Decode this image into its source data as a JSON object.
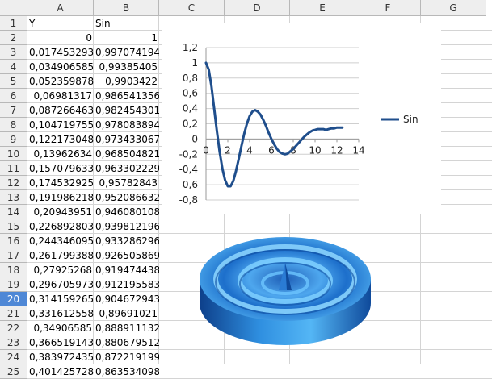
{
  "columns": [
    "A",
    "B",
    "C",
    "D",
    "E",
    "F",
    "G"
  ],
  "rows": [
    "1",
    "2",
    "3",
    "4",
    "5",
    "6",
    "7",
    "8",
    "9",
    "10",
    "11",
    "12",
    "13",
    "14",
    "15",
    "16",
    "17",
    "18",
    "19",
    "20",
    "21",
    "22",
    "23",
    "24",
    "25"
  ],
  "selected_row": "20",
  "headers": {
    "a1": "Y",
    "b1": "Sin"
  },
  "cells_a": [
    "0",
    "0,017453293",
    "0,034906585",
    "0,052359878",
    "0,06981317",
    "0,087266463",
    "0,104719755",
    "0,122173048",
    "0,13962634",
    "0,157079633",
    "0,174532925",
    "0,191986218",
    "0,20943951",
    "0,226892803",
    "0,244346095",
    "0,261799388",
    "0,27925268",
    "0,296705973",
    "0,314159265",
    "0,331612558",
    "0,34906585",
    "0,366519143",
    "0,383972435",
    "0,401425728"
  ],
  "cells_b": [
    "1",
    "0,997074194",
    "0,99385405",
    "0,9903422",
    "0,986541356",
    "0,982454301",
    "0,978083894",
    "0,973433067",
    "0,968504821",
    "0,963302229",
    "0,95782843",
    "0,952086632",
    "0,946080108",
    "0,939812196",
    "0,933286296",
    "0,926505869",
    "0,919474438",
    "0,912195583",
    "0,904672943",
    "0,89691021",
    "0,888911132",
    "0,880679512",
    "0,872219199",
    "0,863534098"
  ],
  "chart_data": {
    "type": "line",
    "series": [
      {
        "name": "Sin",
        "color": "#1f4e8c",
        "x": [
          0,
          0.25,
          0.5,
          0.75,
          1,
          1.25,
          1.5,
          1.75,
          2,
          2.25,
          2.5,
          2.75,
          3,
          3.25,
          3.5,
          3.75,
          4,
          4.25,
          4.5,
          4.75,
          5,
          5.25,
          5.5,
          5.75,
          6,
          6.25,
          6.5,
          6.75,
          7,
          7.25,
          7.5,
          7.75,
          8,
          8.25,
          8.5,
          8.75,
          9,
          9.25,
          9.5,
          9.75,
          10,
          10.25,
          10.5,
          10.75,
          11,
          11.25,
          11.5,
          11.75,
          12,
          12.25,
          12.5
        ],
        "y": [
          1,
          0.91,
          0.69,
          0.4,
          0.1,
          -0.17,
          -0.39,
          -0.54,
          -0.62,
          -0.62,
          -0.55,
          -0.42,
          -0.26,
          -0.09,
          0.07,
          0.2,
          0.3,
          0.36,
          0.38,
          0.36,
          0.32,
          0.25,
          0.17,
          0.08,
          0.0,
          -0.07,
          -0.13,
          -0.17,
          -0.19,
          -0.2,
          -0.19,
          -0.16,
          -0.13,
          -0.09,
          -0.05,
          -0.01,
          0.03,
          0.06,
          0.09,
          0.11,
          0.12,
          0.13,
          0.13,
          0.13,
          0.12,
          0.13,
          0.14,
          0.14,
          0.15,
          0.15,
          0.15
        ]
      }
    ],
    "xlim": [
      0,
      14
    ],
    "ylim": [
      -0.8,
      1.2
    ],
    "x_ticks": [
      "0",
      "2",
      "4",
      "6",
      "8",
      "10",
      "12",
      "14"
    ],
    "y_ticks": [
      "1,2",
      "1",
      "0,8",
      "0,6",
      "0,4",
      "0,2",
      "0",
      "-0,2",
      "-0,4",
      "-0,6",
      "-0,8"
    ],
    "grid": true,
    "legend_position": "right"
  },
  "colors": {
    "header_bg": "#eeeeee",
    "selected_row": "#4f88d6",
    "grid": "#d4d4d4",
    "surface": "#2f8fe0"
  },
  "surface_image": "blue-3d-ripple-surface"
}
